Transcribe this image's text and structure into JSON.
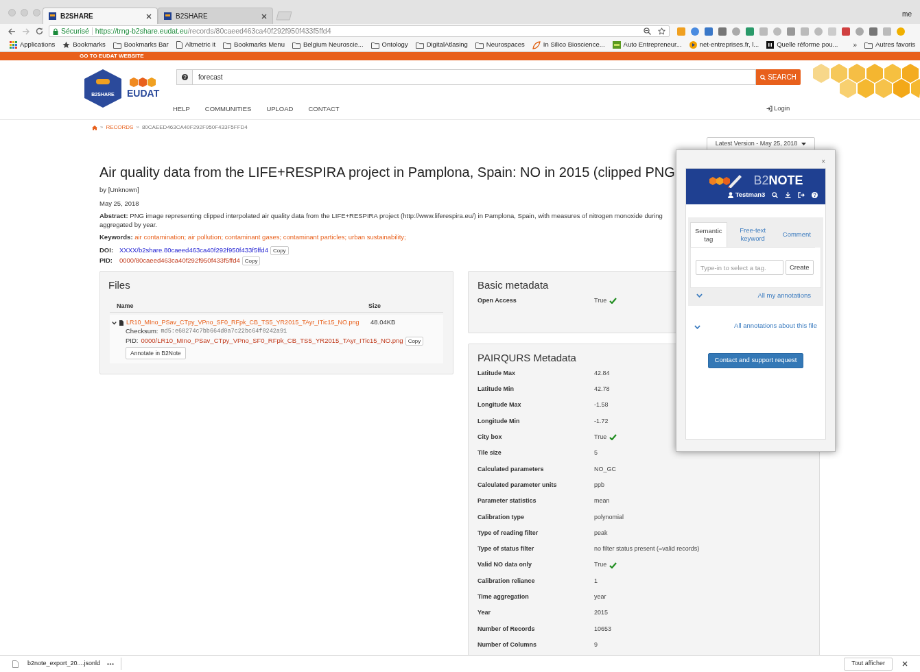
{
  "browser": {
    "tabs": [
      {
        "title": "B2SHARE",
        "selected": true
      },
      {
        "title": "B2SHARE",
        "selected": false
      }
    ],
    "profile": "me",
    "security_label": "Sécurisé",
    "url_host": "https://trng-b2share.eudat.eu",
    "url_path": "/records/80caeed463ca40f292f950f433f5ffd4",
    "bookmarks": [
      {
        "kind": "apps",
        "label": "Applications"
      },
      {
        "kind": "star",
        "label": "Bookmarks"
      },
      {
        "kind": "folder",
        "label": "Bookmarks Bar"
      },
      {
        "kind": "page",
        "label": "Altmetric it"
      },
      {
        "kind": "folder",
        "label": "Bookmarks Menu"
      },
      {
        "kind": "folder",
        "label": "Belgium Neuroscie..."
      },
      {
        "kind": "folder",
        "label": "Ontology"
      },
      {
        "kind": "folder",
        "label": "DigitalAtlasing"
      },
      {
        "kind": "folder",
        "label": "Neurospaces"
      },
      {
        "kind": "leaf",
        "label": "In Silico Bioscience..."
      },
      {
        "kind": "badge",
        "label": "Auto Entrepreneur..."
      },
      {
        "kind": "play",
        "label": "net-entreprises.fr, l..."
      },
      {
        "kind": "square",
        "label": "Quelle réforme pou..."
      }
    ],
    "overflow": "»",
    "other_bookmarks": "Autres favoris"
  },
  "banner": "GO TO EUDAT WEBSITE",
  "header": {
    "logo_text": "B2SHARE",
    "brand": "EUDAT",
    "search_value": "forecast",
    "search_button": "SEARCH",
    "nav": [
      "HELP",
      "COMMUNITIES",
      "UPLOAD",
      "CONTACT"
    ],
    "login": "Login"
  },
  "breadcrumb": [
    {
      "separator": "»",
      "label": "RECORDS"
    },
    {
      "separator": "»",
      "label": "80CAEED463CA40F292F950F433F5FFD4"
    }
  ],
  "version_select": "Latest Version - May 25, 2018",
  "record": {
    "title": "Air quality data from the LIFE+RESPIRA project in Pamplona, Spain: NO in 2015 (clipped PNG",
    "author": "by [Unknown]",
    "date": "May 25, 2018",
    "abstract_label": "Abstract:",
    "abstract": "PNG image representing clipped interpolated air quality data from the LIFE+RESPIRA project (http://www.liferespira.eu/) in Pamplona, Spain, with measures of nitrogen monoxide during aggregated by year.",
    "keywords_label": "Keywords:",
    "keywords": "air contamination; air pollution; contaminant gases; contaminant particles; urban sustainability;",
    "doi_label": "DOI:",
    "doi": "XXXX/b2share.80caeed463ca40f292f950f433f5ffd4",
    "pid_label": "PID:",
    "pid": "0000/80caeed463ca40f292f950f433f5ffd4",
    "doi_copy": "Copy",
    "pid_copy": "Copy"
  },
  "files": {
    "title": "Files",
    "columns": [
      "Name",
      "Size"
    ],
    "rows": [
      {
        "name": "LR10_MIno_PSav_CTpy_VPno_SF0_RFpk_CB_TS5_YR2015_TAyr_ITic15_NO.png",
        "size": "48.04KB",
        "expanded": true,
        "checksum_label": "Checksum:",
        "checksum": "md5:e68274c7bb664d0a7c22bc64f0242a91",
        "pid_label": "PID:",
        "pid": "0000/LR10_MIno_PSav_CTpy_VPno_SF0_RFpk_CB_TS5_YR2015_TAyr_ITic15_NO.png",
        "copy": "Copy",
        "annotate": "Annotate in B2Note"
      }
    ]
  },
  "basic_metadata": {
    "title": "Basic metadata",
    "rows": [
      {
        "label": "Open Access",
        "value": "True",
        "check": true
      }
    ]
  },
  "pairqurs": {
    "title": "PAIRQURS Metadata",
    "rows": [
      {
        "label": "Latitude Max",
        "value": "42.84",
        "check": false
      },
      {
        "label": "Latitude Min",
        "value": "42.78",
        "check": false
      },
      {
        "label": "Longitude Max",
        "value": "-1.58",
        "check": false
      },
      {
        "label": "Longitude Min",
        "value": "-1.72",
        "check": false
      },
      {
        "label": "City box",
        "value": "True",
        "check": true
      },
      {
        "label": "Tile size",
        "value": "5",
        "check": false
      },
      {
        "label": "Calculated parameters",
        "value": "NO_GC",
        "check": false
      },
      {
        "label": "Calculated parameter units",
        "value": "ppb",
        "check": false
      },
      {
        "label": "Parameter statistics",
        "value": "mean",
        "check": false
      },
      {
        "label": "Calibration type",
        "value": "polynomial",
        "check": false
      },
      {
        "label": "Type of reading filter",
        "value": "peak",
        "check": false
      },
      {
        "label": "Type of status filter",
        "value": "no filter status present (=valid records)",
        "check": false
      },
      {
        "label": "Valid NO data only",
        "value": "True",
        "check": true
      },
      {
        "label": "Calibration reliance",
        "value": "1",
        "check": false
      },
      {
        "label": "Time aggregation",
        "value": "year",
        "check": false
      },
      {
        "label": "Year",
        "value": "2015",
        "check": false
      },
      {
        "label": "Number of Records",
        "value": "10653",
        "check": false
      },
      {
        "label": "Number of Columns",
        "value": "9",
        "check": false
      }
    ]
  },
  "b2note": {
    "close": "×",
    "title": "B2**NOTE**",
    "user": "Testman3",
    "tabs": [
      {
        "label": "Semantic tag",
        "selected": true
      },
      {
        "label": "Free-text keyword",
        "selected": false
      },
      {
        "label": "Comment",
        "selected": false
      }
    ],
    "tag_placeholder": "Type-in to select a tag.",
    "create": "Create",
    "my_annotations": "All my annotations",
    "file_annotations": "All annotations about this file",
    "contact": "Contact and support request"
  },
  "downloads": {
    "file": "b2note_export_20....jsonld",
    "show_all": "Tout afficher"
  }
}
